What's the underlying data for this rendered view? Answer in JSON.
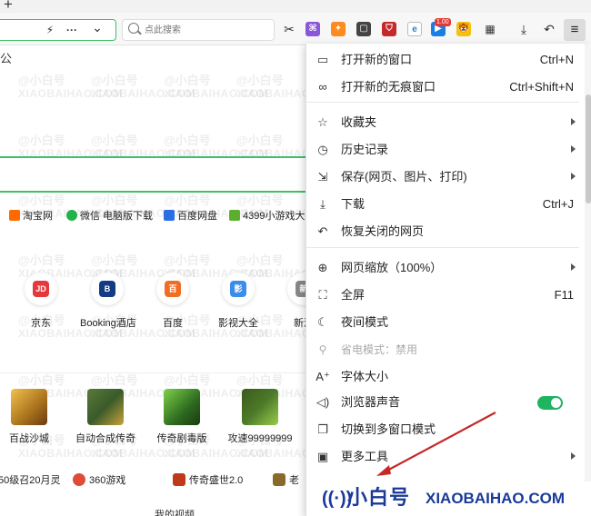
{
  "titlebar": {
    "new_tab": "+"
  },
  "toolbar": {
    "search_placeholder": "点此搜索",
    "more": "···",
    "chevron": "⌄",
    "promo_badge": "1.00",
    "menu": "≡"
  },
  "page": {
    "partial_char": "公",
    "bookmarks": [
      {
        "label": "淘宝网",
        "color": "#ff6a00"
      },
      {
        "label": "微信 电脑版下载",
        "color": "#21b34a"
      },
      {
        "label": "百度网盘",
        "color": "#2a6ee6"
      },
      {
        "label": "4399小游戏大",
        "color": "#5cae2e"
      }
    ],
    "sites": [
      {
        "label": "京东",
        "glyph": "JD",
        "color": "#e4393c"
      },
      {
        "label": "Booking酒店",
        "glyph": "B",
        "color": "#123b84"
      },
      {
        "label": "百度",
        "glyph": "百",
        "color": "#f06d26"
      },
      {
        "label": "影视大全",
        "glyph": "影",
        "color": "#3b8de8"
      },
      {
        "label": "新浪",
        "glyph": "新",
        "color": "#888888"
      }
    ],
    "games": [
      {
        "label": "百战沙城",
        "color": "#a8711c"
      },
      {
        "label": "自动合成传奇",
        "color": "#3a5a2a"
      },
      {
        "label": "传奇剧毒版",
        "color": "#2d6b1f"
      },
      {
        "label": "攻速99999999",
        "color": "#4d7a2a"
      }
    ],
    "bottom_links": [
      {
        "label": "50级召20月灵",
        "color": ""
      },
      {
        "label": "360游戏",
        "color": "#e04a3a"
      },
      {
        "label": "传奇盛世2.0",
        "color": "#c0391b"
      },
      {
        "label": "老",
        "color": "#8a6a2a"
      }
    ],
    "last_row": "我的视频"
  },
  "watermark": {
    "line1": "@小白号",
    "line2": "XIAOBAIHAO.COM"
  },
  "menu": {
    "items": [
      {
        "icon": "new-window-icon",
        "glyph": "▭",
        "label": "打开新的窗口",
        "shortcut": "Ctrl+N",
        "submenu": false
      },
      {
        "icon": "incognito-icon",
        "glyph": "∞",
        "label": "打开新的无痕窗口",
        "shortcut": "Ctrl+Shift+N",
        "submenu": false
      },
      {
        "icon": "star-list-icon",
        "glyph": "☆",
        "label": "收藏夹",
        "shortcut": "",
        "submenu": true
      },
      {
        "icon": "history-icon",
        "glyph": "◷",
        "label": "历史记录",
        "shortcut": "",
        "submenu": true
      },
      {
        "icon": "save-icon",
        "glyph": "⇲",
        "label": "保存(网页、图片、打印)",
        "shortcut": "",
        "submenu": true
      },
      {
        "icon": "download-icon",
        "glyph": "⤓",
        "label": "下载",
        "shortcut": "Ctrl+J",
        "submenu": false
      },
      {
        "icon": "restore-icon",
        "glyph": "↶",
        "label": "恢复关闭的网页",
        "shortcut": "",
        "submenu": false
      },
      {
        "icon": "zoom-icon",
        "glyph": "⊕",
        "label": "网页缩放（100%）",
        "shortcut": "",
        "submenu": true
      },
      {
        "icon": "fullscreen-icon",
        "glyph": "⛶",
        "label": "全屏",
        "shortcut": "F11",
        "submenu": false
      },
      {
        "icon": "moon-icon",
        "glyph": "☾",
        "label": "夜间模式",
        "shortcut": "",
        "submenu": false
      },
      {
        "icon": "power-save-icon",
        "glyph": "⚲",
        "label": "省电模式：禁用",
        "shortcut": "",
        "submenu": false,
        "disabled": true
      },
      {
        "icon": "font-size-icon",
        "glyph": "A⁺",
        "label": "字体大小",
        "shortcut": "",
        "submenu": false
      },
      {
        "icon": "speaker-icon",
        "glyph": "◁)",
        "label": "浏览器声音",
        "shortcut": "",
        "submenu": false,
        "toggle": true
      },
      {
        "icon": "multi-window-icon",
        "glyph": "❐",
        "label": "切换到多窗口模式",
        "shortcut": "",
        "submenu": false
      },
      {
        "icon": "toolbox-icon",
        "glyph": "▣",
        "label": "更多工具",
        "shortcut": "",
        "submenu": true
      }
    ],
    "sound_toggle_on": true
  },
  "brand": {
    "cn": "小白号",
    "en": "XIAOBAIHAO.COM"
  }
}
